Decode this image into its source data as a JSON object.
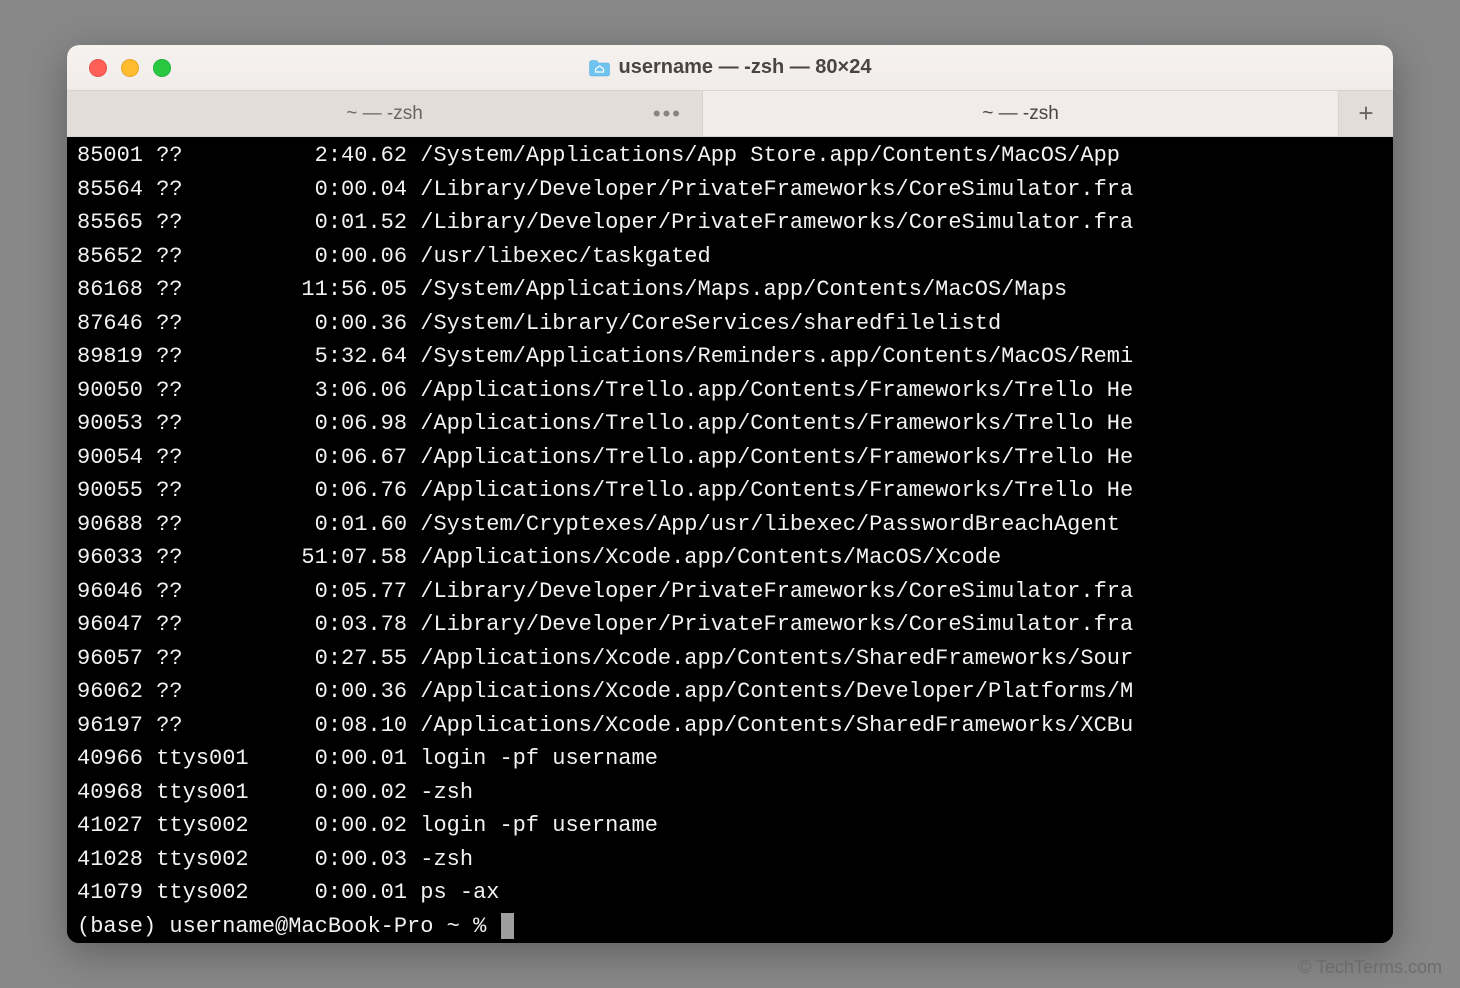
{
  "window": {
    "title": "username — -zsh — 80×24"
  },
  "tabs": [
    {
      "label": "~ — -zsh",
      "active": false,
      "hasOverflow": true
    },
    {
      "label": "~ — -zsh",
      "active": true,
      "hasOverflow": false
    }
  ],
  "newTabLabel": "+",
  "processes": [
    {
      "pid": "85001",
      "tty": "??",
      "time": "2:40.62",
      "cmd": "/System/Applications/App Store.app/Contents/MacOS/App"
    },
    {
      "pid": "85564",
      "tty": "??",
      "time": "0:00.04",
      "cmd": "/Library/Developer/PrivateFrameworks/CoreSimulator.fra"
    },
    {
      "pid": "85565",
      "tty": "??",
      "time": "0:01.52",
      "cmd": "/Library/Developer/PrivateFrameworks/CoreSimulator.fra"
    },
    {
      "pid": "85652",
      "tty": "??",
      "time": "0:00.06",
      "cmd": "/usr/libexec/taskgated"
    },
    {
      "pid": "86168",
      "tty": "??",
      "time": "11:56.05",
      "cmd": "/System/Applications/Maps.app/Contents/MacOS/Maps"
    },
    {
      "pid": "87646",
      "tty": "??",
      "time": "0:00.36",
      "cmd": "/System/Library/CoreServices/sharedfilelistd"
    },
    {
      "pid": "89819",
      "tty": "??",
      "time": "5:32.64",
      "cmd": "/System/Applications/Reminders.app/Contents/MacOS/Remi"
    },
    {
      "pid": "90050",
      "tty": "??",
      "time": "3:06.06",
      "cmd": "/Applications/Trello.app/Contents/Frameworks/Trello He"
    },
    {
      "pid": "90053",
      "tty": "??",
      "time": "0:06.98",
      "cmd": "/Applications/Trello.app/Contents/Frameworks/Trello He"
    },
    {
      "pid": "90054",
      "tty": "??",
      "time": "0:06.67",
      "cmd": "/Applications/Trello.app/Contents/Frameworks/Trello He"
    },
    {
      "pid": "90055",
      "tty": "??",
      "time": "0:06.76",
      "cmd": "/Applications/Trello.app/Contents/Frameworks/Trello He"
    },
    {
      "pid": "90688",
      "tty": "??",
      "time": "0:01.60",
      "cmd": "/System/Cryptexes/App/usr/libexec/PasswordBreachAgent"
    },
    {
      "pid": "96033",
      "tty": "??",
      "time": "51:07.58",
      "cmd": "/Applications/Xcode.app/Contents/MacOS/Xcode"
    },
    {
      "pid": "96046",
      "tty": "??",
      "time": "0:05.77",
      "cmd": "/Library/Developer/PrivateFrameworks/CoreSimulator.fra"
    },
    {
      "pid": "96047",
      "tty": "??",
      "time": "0:03.78",
      "cmd": "/Library/Developer/PrivateFrameworks/CoreSimulator.fra"
    },
    {
      "pid": "96057",
      "tty": "??",
      "time": "0:27.55",
      "cmd": "/Applications/Xcode.app/Contents/SharedFrameworks/Sour"
    },
    {
      "pid": "96062",
      "tty": "??",
      "time": "0:00.36",
      "cmd": "/Applications/Xcode.app/Contents/Developer/Platforms/M"
    },
    {
      "pid": "96197",
      "tty": "??",
      "time": "0:08.10",
      "cmd": "/Applications/Xcode.app/Contents/SharedFrameworks/XCBu"
    },
    {
      "pid": "40966",
      "tty": "ttys001",
      "time": "0:00.01",
      "cmd": "login -pf username"
    },
    {
      "pid": "40968",
      "tty": "ttys001",
      "time": "0:00.02",
      "cmd": "-zsh"
    },
    {
      "pid": "41027",
      "tty": "ttys002",
      "time": "0:00.02",
      "cmd": "login -pf username"
    },
    {
      "pid": "41028",
      "tty": "ttys002",
      "time": "0:00.03",
      "cmd": "-zsh"
    },
    {
      "pid": "41079",
      "tty": "ttys002",
      "time": "0:00.01",
      "cmd": "ps -ax"
    }
  ],
  "prompt": "(base) username@MacBook-Pro ~ % ",
  "watermark": "© TechTerms.com"
}
